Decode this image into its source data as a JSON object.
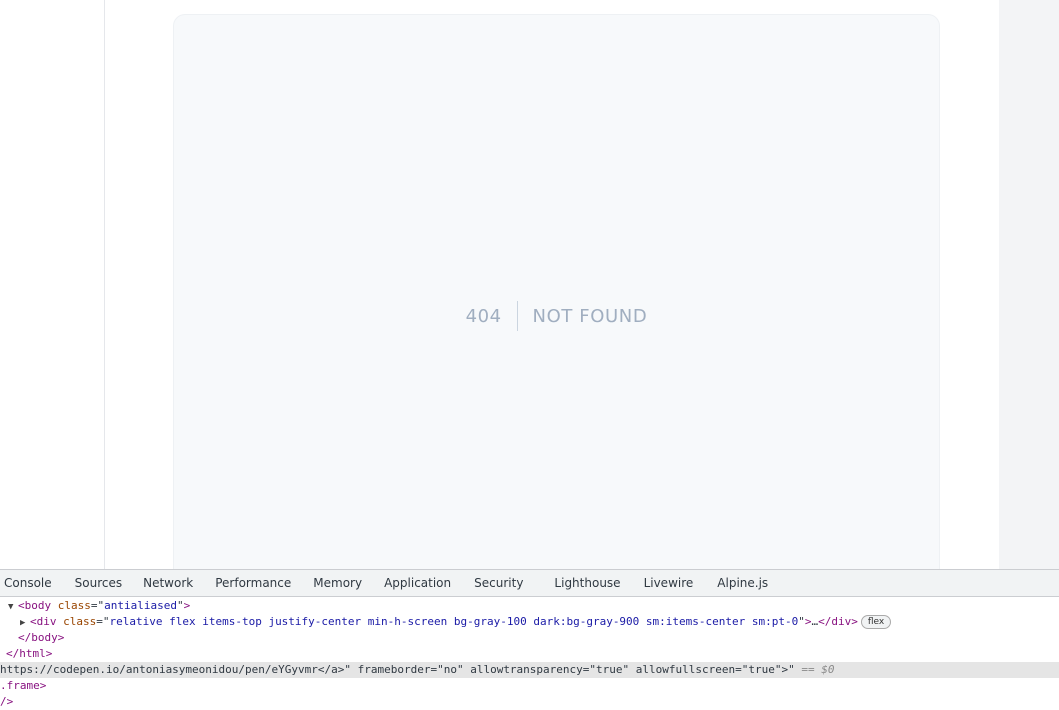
{
  "page": {
    "error_code": "404",
    "error_text": "NOT FOUND"
  },
  "devtools": {
    "tabs": [
      "Console",
      "Sources",
      "Network",
      "Performance",
      "Memory",
      "Application",
      "Security",
      "Lighthouse",
      "Livewire",
      "Alpine.js"
    ],
    "lines": {
      "body_open_tag": "body",
      "body_attr": "class",
      "body_class": "antialiased",
      "div_tag": "div",
      "div_attr": "class",
      "div_class": "relative flex items-top justify-center min-h-screen bg-gray-100 dark:bg-gray-900 sm:items-center sm:pt-0",
      "div_ellipsis": "…",
      "flex_badge": "flex",
      "body_close": "</body>",
      "html_close": "</html>",
      "iframe_fragment": "https://codepen.io/antoniasymeonidou/pen/eYGyvmr</a>\" frameborder=\"no\" allowtransparency=\"true\" allowfullscreen=\"true\">\"",
      "selected_marker": "== $0",
      "iframe_close": ".frame>",
      "last_fragment": "/>"
    }
  }
}
